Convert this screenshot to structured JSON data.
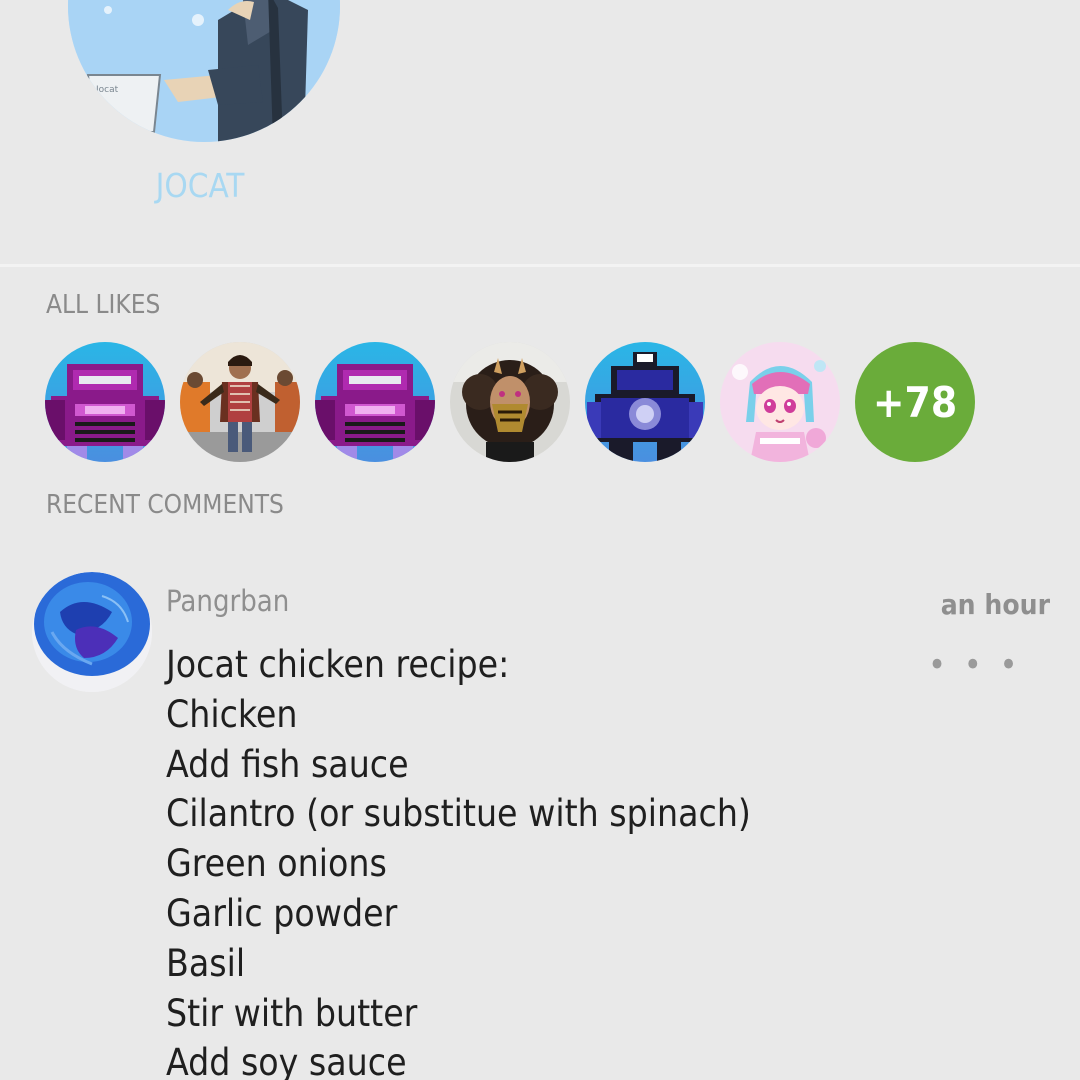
{
  "profile": {
    "name": "JOCAT",
    "avatar_icon": "profile-avatar-illustration",
    "name_color": "#a8d8f2"
  },
  "likes": {
    "title": "ALL LIKES",
    "avatars": [
      {
        "icon": "robot-avatar-purple"
      },
      {
        "icon": "person-photo-avatar"
      },
      {
        "icon": "robot-avatar-purple"
      },
      {
        "icon": "masked-person-avatar"
      },
      {
        "icon": "robot-avatar-blue"
      },
      {
        "icon": "anime-girl-avatar"
      }
    ],
    "more_count": "+78",
    "more_color": "#6aac3a"
  },
  "comments": {
    "title": "RECENT COMMENTS",
    "items": [
      {
        "author": "Pangrban",
        "time": "an hour",
        "more_label": "• • •",
        "avatar_icon": "blue-abstract-avatar",
        "lines": [
          "Jocat chicken recipe:",
          "Chicken",
          "Add fish sauce",
          "Cilantro (or substitue with spinach)",
          "Green onions",
          "Garlic powder",
          "Basil",
          "Stir with butter",
          "Add soy sauce"
        ]
      }
    ]
  }
}
